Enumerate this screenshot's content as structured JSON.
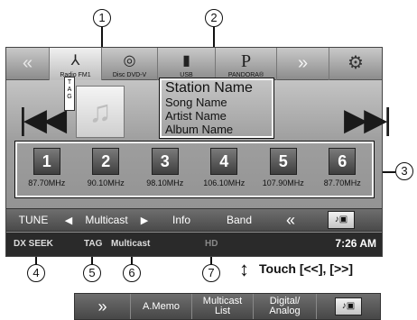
{
  "callouts": [
    "1",
    "2",
    "3",
    "4",
    "5",
    "6",
    "7"
  ],
  "sources": [
    {
      "label": "",
      "icon": "«"
    },
    {
      "label": "Radio FM1",
      "icon": "⅄"
    },
    {
      "label": "Disc DVD-V",
      "icon": "◎"
    },
    {
      "label": "USB",
      "icon": "▮"
    },
    {
      "label": "PANDORA®",
      "icon": "P"
    },
    {
      "label": "",
      "icon": "»"
    },
    {
      "label": "",
      "icon": "⚙"
    }
  ],
  "prev_icon": "|◀◀",
  "next_icon": "▶▶|",
  "tag_strip": "T A G",
  "album_icon": "♫",
  "info": {
    "station": "Station Name",
    "song": "Song Name",
    "artist": "Artist Name",
    "album": "Album Name"
  },
  "presets": [
    {
      "num": "1",
      "freq": "87.70MHz"
    },
    {
      "num": "2",
      "freq": "90.10MHz"
    },
    {
      "num": "3",
      "freq": "98.10MHz"
    },
    {
      "num": "4",
      "freq": "106.10MHz"
    },
    {
      "num": "5",
      "freq": "107.90MHz"
    },
    {
      "num": "6",
      "freq": "87.70MHz"
    }
  ],
  "bottom_bar": {
    "tune": "TUNE",
    "left_tri": "◀",
    "multicast": "Multicast",
    "right_tri": "▶",
    "info": "Info",
    "band": "Band",
    "back": "«",
    "mode": "♪▣"
  },
  "status": {
    "dx_seek": "DX SEEK",
    "tag": "TAG",
    "multicast": "Multicast",
    "hd": "HD",
    "clock": "7:26 AM"
  },
  "touch": {
    "arrow": "↕",
    "label": "Touch [<<], [>>]"
  },
  "alt_bar": {
    "forward": "»",
    "amemo": "A.Memo",
    "multicast_list_1": "Multicast",
    "multicast_list_2": "List",
    "digital_1": "Digital/",
    "digital_2": "Analog",
    "mode": "♪▣"
  }
}
